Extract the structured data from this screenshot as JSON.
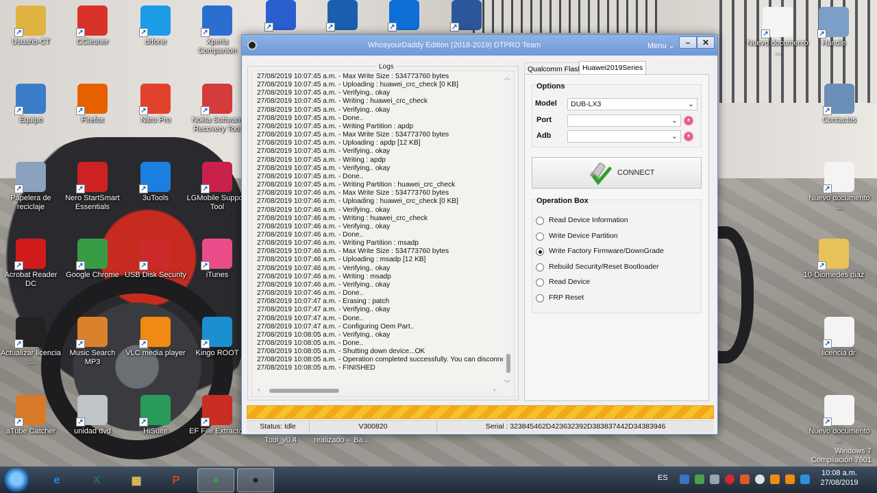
{
  "desktop": {
    "icons": [
      {
        "label": "Usuario-CT",
        "icon": "user-folder-icon",
        "color": "#e0b341"
      },
      {
        "label": "CCleaner",
        "icon": "ccleaner-icon",
        "color": "#d8332a"
      },
      {
        "label": "drfone",
        "icon": "drfone-icon",
        "color": "#1c9be6"
      },
      {
        "label": "Xperia Companion",
        "icon": "xperia-icon",
        "color": "#2a6fd0"
      },
      {
        "label": "",
        "icon": "blue-s-app-icon",
        "color": "#2a5fcf"
      },
      {
        "label": "",
        "icon": "anchor-icon",
        "color": "#1a5fb0"
      },
      {
        "label": "",
        "icon": "teamviewer-icon",
        "color": "#0e6fd7"
      },
      {
        "label": "",
        "icon": "word-document-icon",
        "color": "#2b579a"
      },
      {
        "label": "Nuevo documento ...",
        "icon": "new-document-icon",
        "color": "#f4f4f4"
      },
      {
        "label": "Handle",
        "icon": "handle-gear-icon",
        "color": "#7a9fc8"
      },
      {
        "label": "Equipo",
        "icon": "computer-icon",
        "color": "#3d7cc9"
      },
      {
        "label": "Firefox",
        "icon": "firefox-icon",
        "color": "#e66000"
      },
      {
        "label": "Nitro Pro",
        "icon": "nitro-pro-icon",
        "color": "#e2412b"
      },
      {
        "label": "Nokia Software Recovery Tool",
        "icon": "nokia-recovery-icon",
        "color": "#d43b3b"
      },
      {
        "label": "Contactos",
        "icon": "contacts-icon",
        "color": "#6a8fb8"
      },
      {
        "label": "Papelera de reciclaje",
        "icon": "recycle-bin-icon",
        "color": "#8aa2bd"
      },
      {
        "label": "Nero StartSmart Essentials",
        "icon": "nero-icon",
        "color": "#cc2222"
      },
      {
        "label": "3uTools",
        "icon": "3utools-icon",
        "color": "#1c7fe0"
      },
      {
        "label": "LGMobile Support Tool",
        "icon": "lg-mobile-icon",
        "color": "#c8224a"
      },
      {
        "label": "Nuevo documento ...",
        "icon": "new-document-icon",
        "color": "#f4f4f4"
      },
      {
        "label": "Acrobat Reader DC",
        "icon": "acrobat-icon",
        "color": "#d21b1b"
      },
      {
        "label": "Google Chrome",
        "icon": "chrome-icon",
        "color": "#3a9b46"
      },
      {
        "label": "USB Disk Security",
        "icon": "usb-disk-security-icon",
        "color": "#cc2a2a"
      },
      {
        "label": "iTunes",
        "icon": "itunes-icon",
        "color": "#e94e8a"
      },
      {
        "label": "10-Diomedes diaz",
        "icon": "folder-icon",
        "color": "#e8c25a"
      },
      {
        "label": "Actualizar licencia ...",
        "icon": "update-license-icon",
        "color": "#222222"
      },
      {
        "label": "Music Search MP3",
        "icon": "music-search-icon",
        "color": "#d9822b"
      },
      {
        "label": "VLC media player",
        "icon": "vlc-icon",
        "color": "#ef8a13"
      },
      {
        "label": "Kingo ROOT",
        "icon": "kingo-root-icon",
        "color": "#1c8fd1"
      },
      {
        "label": "licencia dr.",
        "icon": "new-document-icon",
        "color": "#f4f4f4"
      },
      {
        "label": "aTube Catcher",
        "icon": "atube-catcher-icon",
        "color": "#d97a28"
      },
      {
        "label": "unidad dvd",
        "icon": "dvd-drive-icon",
        "color": "#bfc4c9"
      },
      {
        "label": "HiSuite",
        "icon": "hisuite-icon",
        "color": "#2a9a5a"
      },
      {
        "label": "EF File Extractor",
        "icon": "ef-extractor-icon",
        "color": "#c92d22"
      },
      {
        "label": "Nuevo documento ...",
        "icon": "new-document-icon",
        "color": "#f4f4f4"
      }
    ],
    "behind_text": [
      "Tool_v0.4",
      "realizado -- Ba..."
    ],
    "watermark": {
      "line1": "Windows 7",
      "line2": "Compilación 7601"
    }
  },
  "window": {
    "title": "WhosyourDaddy Edition (2018-2019) DTPRO Team",
    "menu_label": "Menu",
    "minimize_label": "–",
    "close_label": "✕",
    "logs_title": "Logs",
    "log_lines": [
      "27/08/2019 10:07:45 a.m. - Max Write Size : 534773760 bytes",
      "27/08/2019 10:07:45 a.m. - Uploading : huawei_crc_check [0 KB]",
      "27/08/2019 10:07:45 a.m. - Verifying.. okay",
      "27/08/2019 10:07:45 a.m. - Writing : huawei_crc_check",
      "27/08/2019 10:07:45 a.m. - Verifying.. okay",
      "27/08/2019 10:07:45 a.m. - Done..",
      "27/08/2019 10:07:45 a.m. - Writing Partition : apdp",
      "27/08/2019 10:07:45 a.m. - Max Write Size : 534773760 bytes",
      "27/08/2019 10:07:45 a.m. - Uploading : apdp [12 KB]",
      "27/08/2019 10:07:45 a.m. - Verifying.. okay",
      "27/08/2019 10:07:45 a.m. - Writing : apdp",
      "27/08/2019 10:07:45 a.m. - Verifying.. okay",
      "27/08/2019 10:07:45 a.m. - Done..",
      "27/08/2019 10:07:45 a.m. - Writing Partition : huawei_crc_check",
      "27/08/2019 10:07:46 a.m. - Max Write Size : 534773760 bytes",
      "27/08/2019 10:07:46 a.m. - Uploading : huawei_crc_check [0 KB]",
      "27/08/2019 10:07:46 a.m. - Verifying.. okay",
      "27/08/2019 10:07:46 a.m. - Writing : huawei_crc_check",
      "27/08/2019 10:07:46 a.m. - Verifying.. okay",
      "27/08/2019 10:07:46 a.m. - Done..",
      "27/08/2019 10:07:46 a.m. - Writing Partition : msadp",
      "27/08/2019 10:07:46 a.m. - Max Write Size : 534773760 bytes",
      "27/08/2019 10:07:46 a.m. - Uploading : msadp [12 KB]",
      "27/08/2019 10:07:46 a.m. - Verifying.. okay",
      "27/08/2019 10:07:46 a.m. - Writing : msadp",
      "27/08/2019 10:07:46 a.m. - Verifying.. okay",
      "27/08/2019 10:07:46 a.m. - Done..",
      "27/08/2019 10:07:47 a.m. - Erasing : patch",
      "27/08/2019 10:07:47 a.m. - Verifying.. okay",
      "27/08/2019 10:07:47 a.m. - Done..",
      "27/08/2019 10:07:47 a.m. - Configuring Oem Part..",
      "27/08/2019 10:08:05 a.m. - Verifying.. okay",
      "27/08/2019 10:08:05 a.m. - Done..",
      "27/08/2019 10:08:05 a.m. - Shutting down device...OK",
      "27/08/2019 10:08:05 a.m. - Operation completed successfully. You can disconne",
      "27/08/2019 10:08:05 a.m. - FINISHED"
    ],
    "tabs": [
      "Qualcomm Flash",
      "Huawei2019Series"
    ],
    "active_tab": "Huawei2019Series",
    "options": {
      "title": "Options",
      "model_label": "Model",
      "model_value": "DUB-LX3",
      "port_label": "Port",
      "port_value": "",
      "adb_label": "Adb",
      "adb_value": ""
    },
    "connect_label": "CONNECT",
    "operation_box": {
      "title": "Operation Box",
      "items": [
        {
          "label": "Read Device Information",
          "checked": false
        },
        {
          "label": "Write Device Partition",
          "checked": false
        },
        {
          "label": "Write Factory Firmware/DownGrade",
          "checked": true
        },
        {
          "label": "Rebuild Security/Reset Bootloader",
          "checked": false
        },
        {
          "label": "Read Device",
          "checked": false
        },
        {
          "label": "FRP Reset",
          "checked": false
        }
      ]
    },
    "progress_fraction": 1.0,
    "status": {
      "status_text": "Status: Idle",
      "version": "V300820",
      "serial": "Serial : 323845462D423632392D383837442D34383946"
    }
  },
  "taskbar": {
    "items": [
      {
        "name": "internet-explorer",
        "glyph": "e",
        "color": "#1f8be0"
      },
      {
        "name": "excel",
        "glyph": "X",
        "color": "#207245"
      },
      {
        "name": "file-explorer",
        "glyph": "▦",
        "color": "#e8c25a"
      },
      {
        "name": "powerpoint",
        "glyph": "P",
        "color": "#d24726"
      },
      {
        "name": "chrome",
        "glyph": "●",
        "color": "#3a9b46"
      },
      {
        "name": "dtpro-tool",
        "glyph": "●",
        "color": "#222222"
      }
    ],
    "language": "ES",
    "time": "10:08 a.m.",
    "date": "27/08/2019"
  }
}
